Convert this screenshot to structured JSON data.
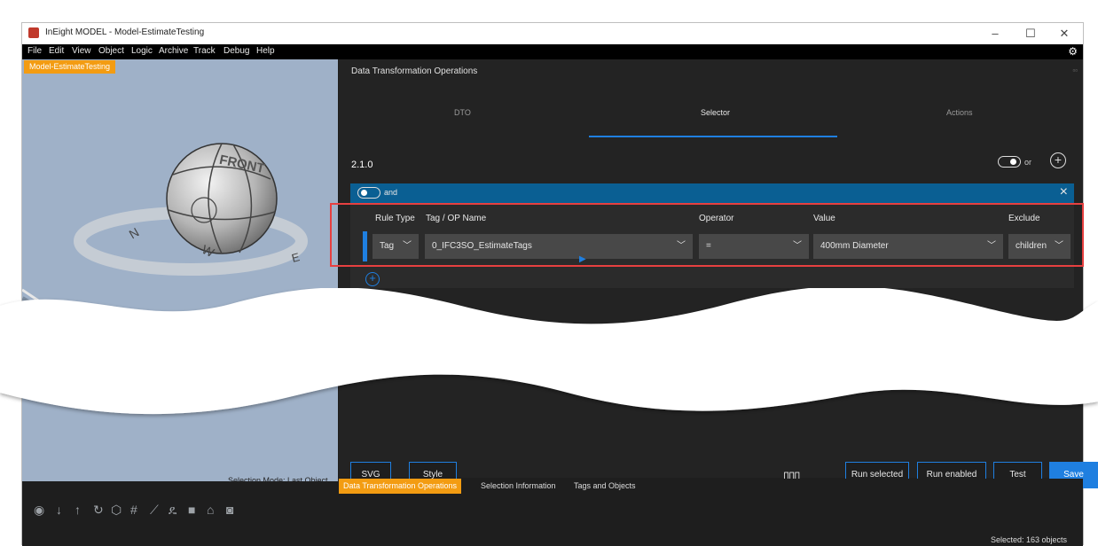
{
  "window": {
    "title": "InEight MODEL - Model-EstimateTesting",
    "controls": [
      "–",
      "☐",
      "✕"
    ]
  },
  "menu": [
    "File",
    "Edit",
    "View",
    "Object",
    "Logic",
    "Archive",
    "Track",
    "Debug",
    "Help"
  ],
  "viewport": {
    "tab_label": "Model-EstimateTesting",
    "compass_labels": {
      "front": "FRONT",
      "north": "N",
      "west": "W",
      "east": "E"
    },
    "selection_mode": "Selection Mode: Last Object"
  },
  "panel": {
    "title": "Data Transformation Operations",
    "tabs": [
      "DTO",
      "Selector",
      "Actions"
    ],
    "active_tab": "Selector",
    "version": "2.1.0",
    "or_label": "or",
    "and_label": "and",
    "rule": {
      "headers": {
        "rule_type": "Rule Type",
        "tag_name": "Tag / OP Name",
        "operator": "Operator",
        "value": "Value",
        "exclude": "Exclude"
      },
      "rule_type": "Tag",
      "tag_name": "0_IFC3SO_EstimateTags",
      "operator": "=",
      "value": "400mm Diameter",
      "exclude": "children"
    },
    "buttons": {
      "svg": "SVG",
      "style": "Style",
      "run_selected": "Run selected",
      "run_enabled": "Run enabled",
      "test": "Test",
      "save": "Save"
    }
  },
  "bottom_tabs": [
    "Data Transformation Operations",
    "Selection Information",
    "Tags and Objects"
  ],
  "status": {
    "selected": "Selected: 163 objects"
  },
  "colors": {
    "accent": "#1f7fe0",
    "orange": "#f39c12",
    "and_bar": "#0a5f93",
    "highlight": "#e74040"
  }
}
